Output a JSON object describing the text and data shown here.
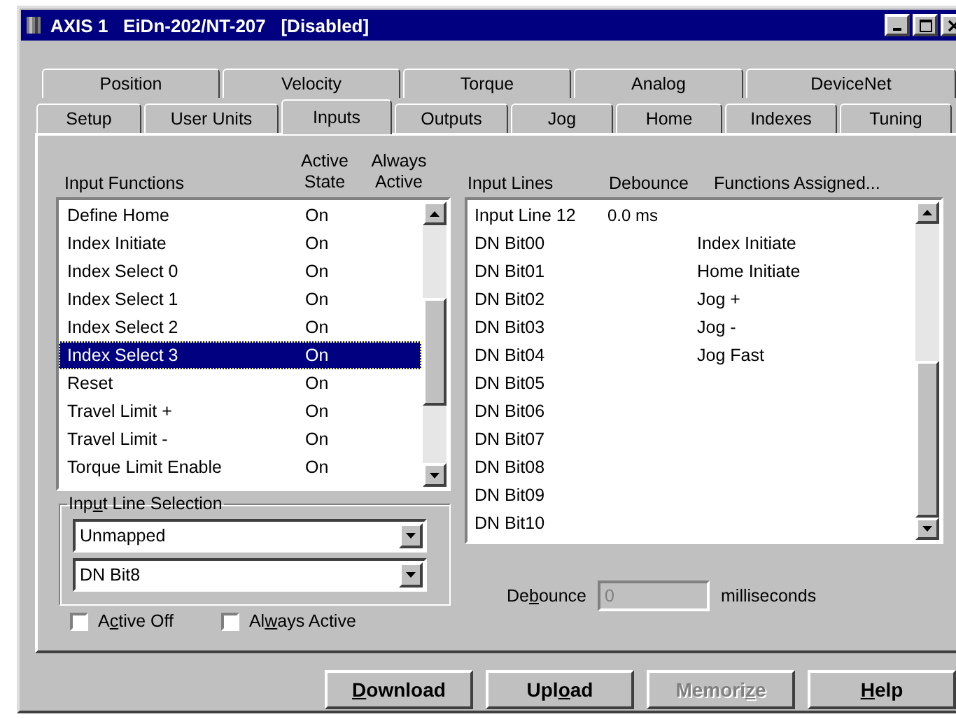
{
  "window": {
    "title": "AXIS 1   EiDn-202/NT-207   [Disabled]"
  },
  "tab_rows": [
    [
      {
        "label": "Position",
        "selected": false
      },
      {
        "label": "Velocity",
        "selected": false
      },
      {
        "label": "Torque",
        "selected": false
      },
      {
        "label": "Analog",
        "selected": false
      },
      {
        "label": "DeviceNet",
        "selected": false
      }
    ],
    [
      {
        "label": "Setup",
        "selected": false
      },
      {
        "label": "User Units",
        "selected": false
      },
      {
        "label": "Inputs",
        "selected": true
      },
      {
        "label": "Outputs",
        "selected": false
      },
      {
        "label": "Jog",
        "selected": false
      },
      {
        "label": "Home",
        "selected": false
      },
      {
        "label": "Indexes",
        "selected": false
      },
      {
        "label": "Tuning",
        "selected": false
      }
    ]
  ],
  "input_functions": {
    "columns": [
      "Input Functions",
      "Active State",
      "Always Active"
    ],
    "rows": [
      {
        "name": "Define Home",
        "active_state": "On",
        "selected": false
      },
      {
        "name": "Index Initiate",
        "active_state": "On",
        "selected": false
      },
      {
        "name": "Index Select 0",
        "active_state": "On",
        "selected": false
      },
      {
        "name": "Index Select 1",
        "active_state": "On",
        "selected": false
      },
      {
        "name": "Index Select 2",
        "active_state": "On",
        "selected": false
      },
      {
        "name": "Index Select 3",
        "active_state": "On",
        "selected": true
      },
      {
        "name": "Reset",
        "active_state": "On",
        "selected": false
      },
      {
        "name": "Travel Limit +",
        "active_state": "On",
        "selected": false
      },
      {
        "name": "Travel Limit -",
        "active_state": "On",
        "selected": false
      },
      {
        "name": "Torque Limit Enable",
        "active_state": "On",
        "selected": false
      }
    ]
  },
  "input_lines": {
    "columns": [
      "Input Lines",
      "Debounce",
      "Functions Assigned..."
    ],
    "rows": [
      {
        "line": "Input Line 12",
        "debounce": "0.0 ms"
      },
      {
        "line": "DN Bit00",
        "function": "Index Initiate"
      },
      {
        "line": "DN Bit01",
        "function": "Home Initiate"
      },
      {
        "line": "DN Bit02",
        "function": "Jog +"
      },
      {
        "line": "DN Bit03",
        "function": "Jog -"
      },
      {
        "line": "DN Bit04",
        "function": "Jog Fast"
      },
      {
        "line": "DN Bit05"
      },
      {
        "line": "DN Bit06"
      },
      {
        "line": "DN Bit07"
      },
      {
        "line": "DN Bit08"
      },
      {
        "line": "DN Bit09"
      },
      {
        "line": "DN Bit10"
      }
    ]
  },
  "input_line_selection": {
    "label": {
      "pre": "Inp",
      "key": "u",
      "post": "t Line Selection"
    },
    "dropdowns": [
      {
        "value": "Unmapped"
      },
      {
        "value": "DN Bit8"
      }
    ]
  },
  "checkboxes": [
    {
      "label": {
        "pre": "A",
        "key": "c",
        "post": "tive Off"
      },
      "checked": false
    },
    {
      "label": {
        "pre": "Al",
        "key": "w",
        "post": "ays Active"
      },
      "checked": false
    }
  ],
  "debounce": {
    "label": {
      "pre": "De",
      "key": "b",
      "post": "ounce"
    },
    "value": "0",
    "unit": "milliseconds",
    "disabled": true
  },
  "buttons": [
    {
      "label": {
        "key": "D",
        "post": "ownload"
      },
      "disabled": false
    },
    {
      "label": {
        "pre": "Upl",
        "key": "o",
        "post": "ad"
      },
      "disabled": false
    },
    {
      "label": {
        "pre": "Memori",
        "key": "z",
        "post": "e"
      },
      "disabled": true
    },
    {
      "label": {
        "key": "H",
        "post": "elp"
      },
      "disabled": false
    }
  ]
}
